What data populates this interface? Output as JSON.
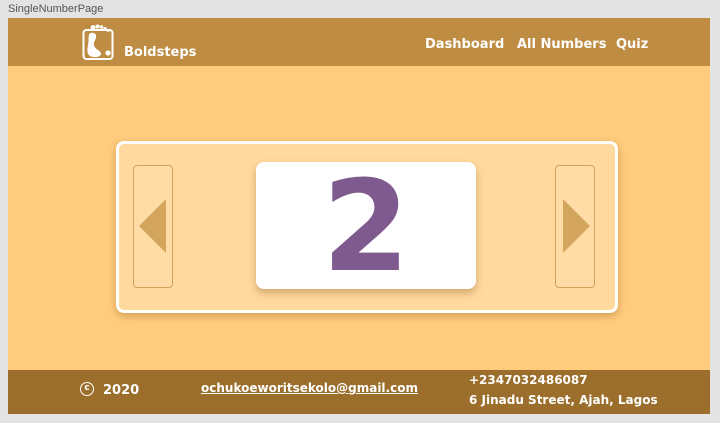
{
  "frame": {
    "label": "SingleNumberPage"
  },
  "header": {
    "logo_icon": "footprint-icon",
    "brand": "Boldsteps",
    "nav": [
      {
        "label": "Dashboard"
      },
      {
        "label": "All Numbers"
      },
      {
        "label": "Quiz"
      }
    ]
  },
  "card": {
    "number": "2",
    "prev_icon": "triangle-left-icon",
    "next_icon": "triangle-right-icon"
  },
  "footer": {
    "copyright_symbol": "c",
    "year": "2020",
    "email": "ochukoeworitsekolo@gmail.com",
    "phone": "+2347032486087",
    "address": "6 Jinadu Street, Ajah, Lagos"
  },
  "colors": {
    "header": "#be8c42",
    "background": "#ffcb7d",
    "card": "#ffd99e",
    "arrow": "#d4a55c",
    "number": "#7e5a8f",
    "footer": "#9c6e2c"
  }
}
